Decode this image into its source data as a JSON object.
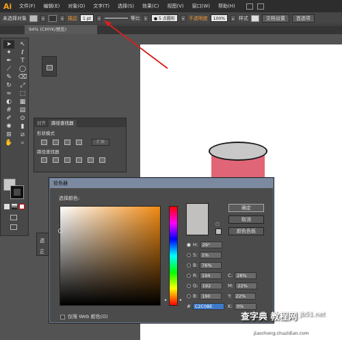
{
  "app": {
    "logo": "Ai"
  },
  "menubar": {
    "items": [
      "文件(F)",
      "编辑(E)",
      "对象(O)",
      "文字(T)",
      "选择(S)",
      "效果(C)",
      "视图(V)",
      "窗口(W)",
      "帮助(H)"
    ]
  },
  "control_bar": {
    "selection_label": "未选择对象",
    "stroke_label": "描边",
    "stroke_weight": "1 pt",
    "stroke_profile": "等比",
    "brush": "● 5 点圆形",
    "opacity_label": "不透明度",
    "opacity_value": "100%",
    "style_label": "样式",
    "doc_setup": "文档设置",
    "prefs_label": "首选项"
  },
  "document": {
    "tab_title": "94% (CMYK/预览)"
  },
  "pathfinder": {
    "tabs": [
      "对齐",
      "路径查找器"
    ],
    "shape_modes_label": "形状模式",
    "pathfinders_label": "路径查找器",
    "expand_label": "扩展"
  },
  "peek_panel": {
    "labels": [
      "透",
      "正"
    ]
  },
  "color_picker": {
    "title": "拾色器",
    "select_color_label": "选择颜色:",
    "ok_label": "确定",
    "cancel_label": "取消",
    "swatches_label": "颜色色板",
    "only_web_colors_label": "仅限 Web 颜色(O)",
    "hsb": [
      {
        "label": "H:",
        "value": "29°",
        "selected": true
      },
      {
        "label": "S:",
        "value": "1%",
        "selected": false
      },
      {
        "label": "B:",
        "value": "76%",
        "selected": false
      }
    ],
    "rgb": [
      {
        "label": "R:",
        "value": "194"
      },
      {
        "label": "G:",
        "value": "192"
      },
      {
        "label": "B:",
        "value": "190"
      }
    ],
    "cmyk": [
      {
        "label": "C:",
        "value": "28%"
      },
      {
        "label": "M:",
        "value": "22%"
      },
      {
        "label": "Y:",
        "value": "22%"
      },
      {
        "label": "K:",
        "value": "0%"
      }
    ],
    "hex_label": "#",
    "hex_value": "C2C0BE",
    "current_color": "#c2c0be"
  },
  "watermark": {
    "text": "查字典 教程网",
    "domain": "jb51.net",
    "url": "jiaocheng.chazidian.com"
  },
  "colors": {
    "accent_orange": "#f7a21b",
    "annotation_arrow": "#d42020",
    "cup_body": "#e06677",
    "cup_top": "#c8c8c8"
  }
}
